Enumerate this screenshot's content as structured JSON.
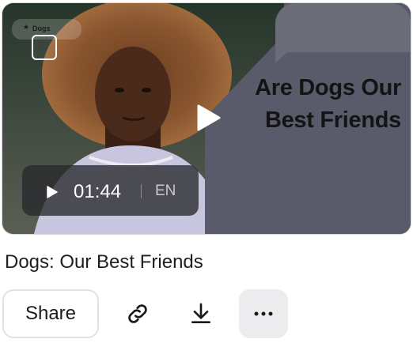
{
  "video": {
    "tag_label": "Dogs",
    "overlay_line1": "Are Dogs Our",
    "overlay_line2": "Best Friends",
    "duration": "01:44",
    "language": "EN",
    "title": "Dogs: Our Best Friends"
  },
  "actions": {
    "share_label": "Share",
    "link_icon": "link-icon",
    "download_icon": "download-icon",
    "more_icon": "more-icon"
  },
  "colors": {
    "panel": "#5b5d6b",
    "text": "#1f1f1f",
    "more_bg": "#ececee"
  }
}
